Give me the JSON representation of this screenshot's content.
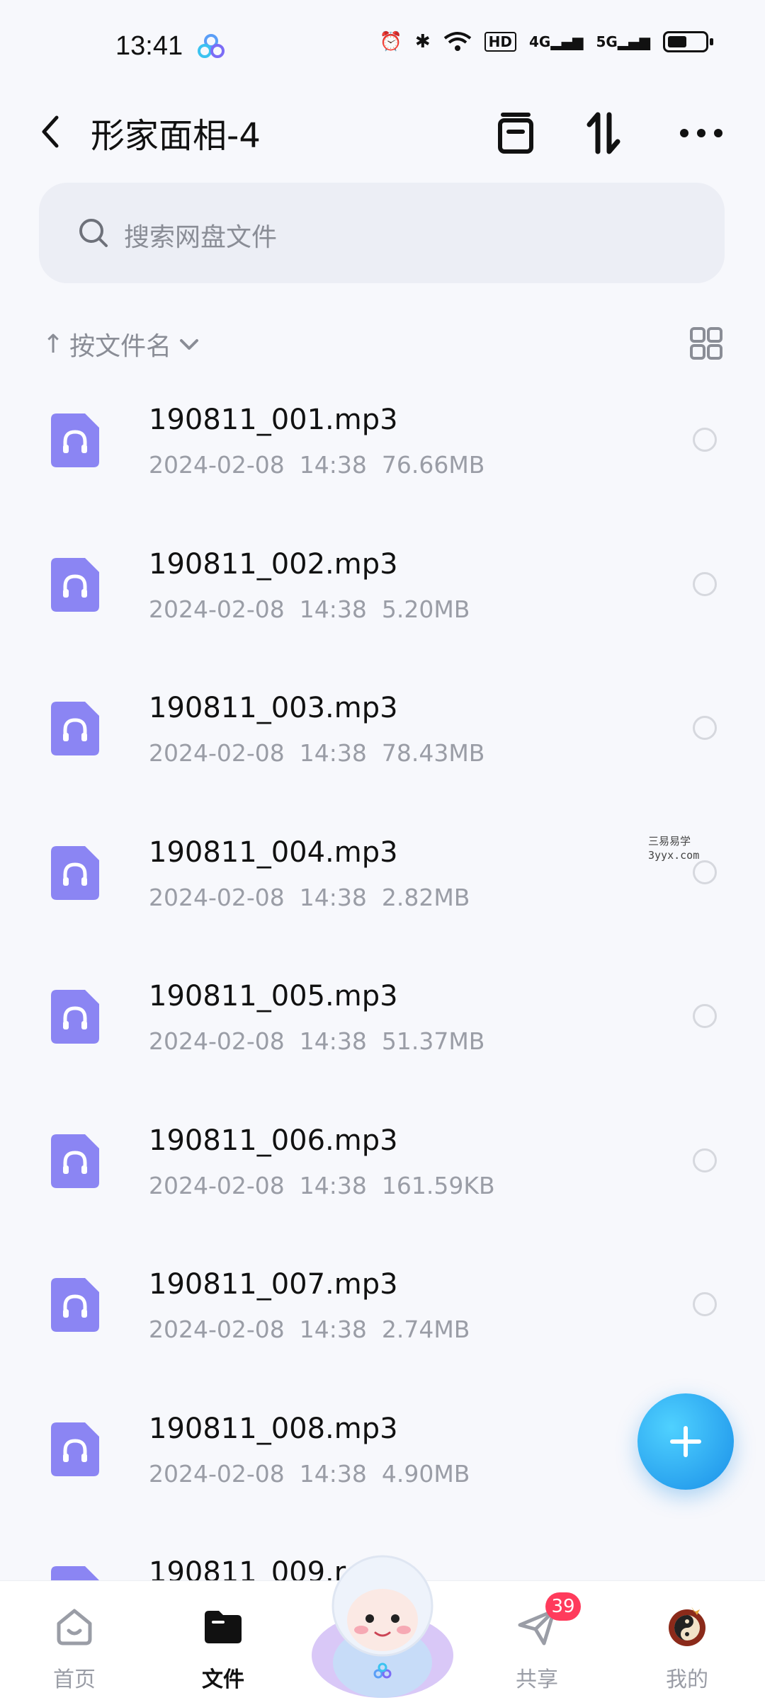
{
  "status_bar": {
    "time": "13:41",
    "hd_label": "HD",
    "net1": "4G",
    "net2": "5G"
  },
  "header": {
    "title": "形家面相-4",
    "back_icon": "chevron-left-icon",
    "icons": [
      "archive-icon",
      "sort-transfer-icon",
      "more-icon"
    ]
  },
  "search": {
    "placeholder": "搜索网盘文件"
  },
  "sort": {
    "arrow": "↑",
    "label": "按文件名"
  },
  "files": [
    {
      "name": "190811_001.mp3",
      "date": "2024-02-08",
      "time": "14:38",
      "size": "76.66MB"
    },
    {
      "name": "190811_002.mp3",
      "date": "2024-02-08",
      "time": "14:38",
      "size": "5.20MB"
    },
    {
      "name": "190811_003.mp3",
      "date": "2024-02-08",
      "time": "14:38",
      "size": "78.43MB"
    },
    {
      "name": "190811_004.mp3",
      "date": "2024-02-08",
      "time": "14:38",
      "size": "2.82MB"
    },
    {
      "name": "190811_005.mp3",
      "date": "2024-02-08",
      "time": "14:38",
      "size": "51.37MB"
    },
    {
      "name": "190811_006.mp3",
      "date": "2024-02-08",
      "time": "14:38",
      "size": "161.59KB"
    },
    {
      "name": "190811_007.mp3",
      "date": "2024-02-08",
      "time": "14:38",
      "size": "2.74MB"
    },
    {
      "name": "190811_008.mp3",
      "date": "2024-02-08",
      "time": "14:38",
      "size": "4.90MB"
    },
    {
      "name": "190811_009.r",
      "date": "",
      "time": "",
      "size": ""
    }
  ],
  "watermark": {
    "line1": "三易易学",
    "line2": "3yyx.com"
  },
  "bottom_nav": {
    "items": [
      {
        "label": "首页",
        "icon": "home-icon"
      },
      {
        "label": "文件",
        "icon": "folder-icon"
      },
      {
        "label": "共享",
        "icon": "share-icon",
        "badge": "39"
      },
      {
        "label": "我的",
        "icon": "avatar-icon"
      }
    ]
  },
  "colors": {
    "accent": "#1a8fe8",
    "file_icon": "#8b85f3",
    "badge": "#ff3b5c"
  }
}
